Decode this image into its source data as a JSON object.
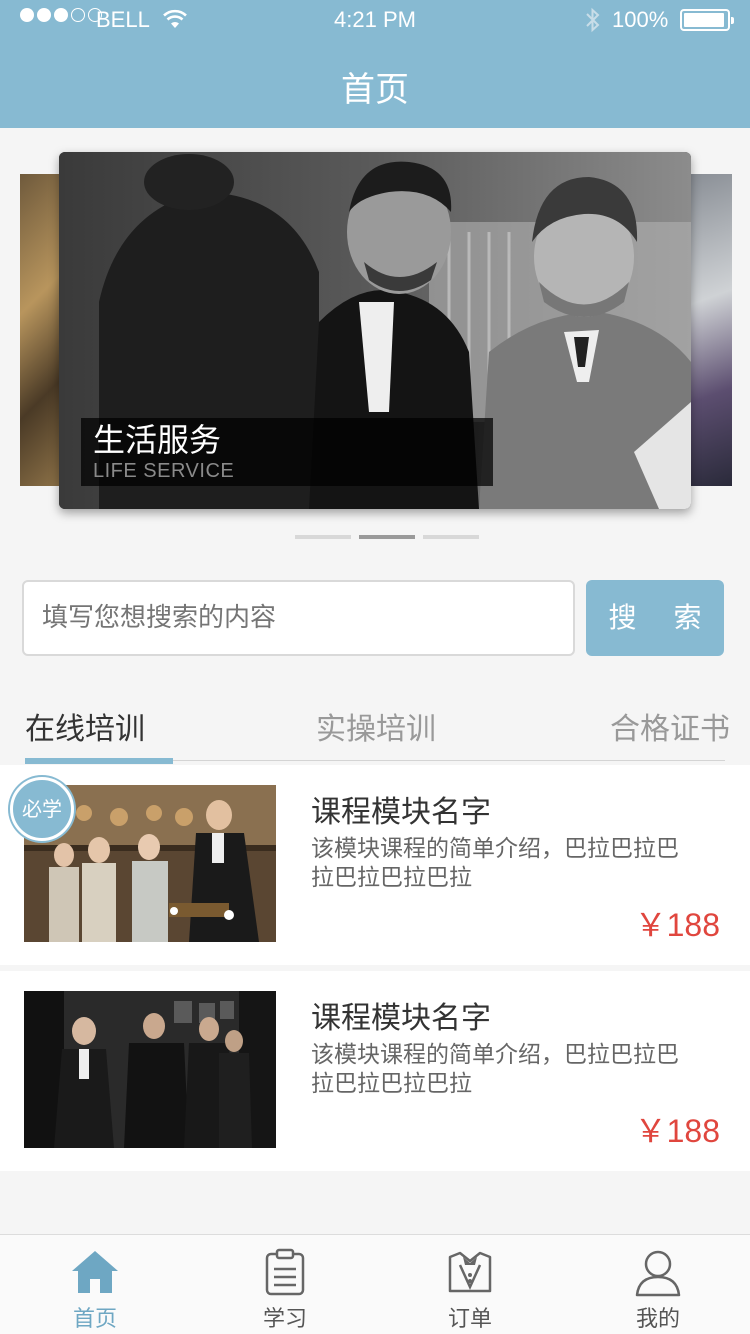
{
  "status_bar": {
    "carrier": "BELL",
    "time": "4:21 PM",
    "battery": "100%"
  },
  "header": {
    "title": "首页"
  },
  "banner": {
    "title": "生活服务",
    "subtitle": "LIFE SERVICE",
    "slide_count": 3,
    "active_index": 1
  },
  "search": {
    "placeholder": "填写您想搜索的内容",
    "button_label": "搜 索"
  },
  "tabs": [
    {
      "label": "在线培训",
      "active": true
    },
    {
      "label": "实操培训",
      "active": false
    },
    {
      "label": "合格证书",
      "active": false
    }
  ],
  "courses": [
    {
      "badge": "必学",
      "title": "课程模块名字",
      "description": "该模块课程的简单介绍，巴拉巴拉巴拉巴拉巴拉巴拉",
      "price": "￥188"
    },
    {
      "title": "课程模块名字",
      "description": "该模块课程的简单介绍，巴拉巴拉巴拉巴拉巴拉巴拉",
      "price": "￥188"
    }
  ],
  "tabbar": [
    {
      "label": "首页",
      "icon": "home-icon",
      "active": true
    },
    {
      "label": "学习",
      "icon": "clipboard-icon",
      "active": false
    },
    {
      "label": "订单",
      "icon": "order-icon",
      "active": false
    },
    {
      "label": "我的",
      "icon": "user-icon",
      "active": false
    }
  ],
  "colors": {
    "accent": "#87bad2",
    "price": "#e0463e"
  }
}
